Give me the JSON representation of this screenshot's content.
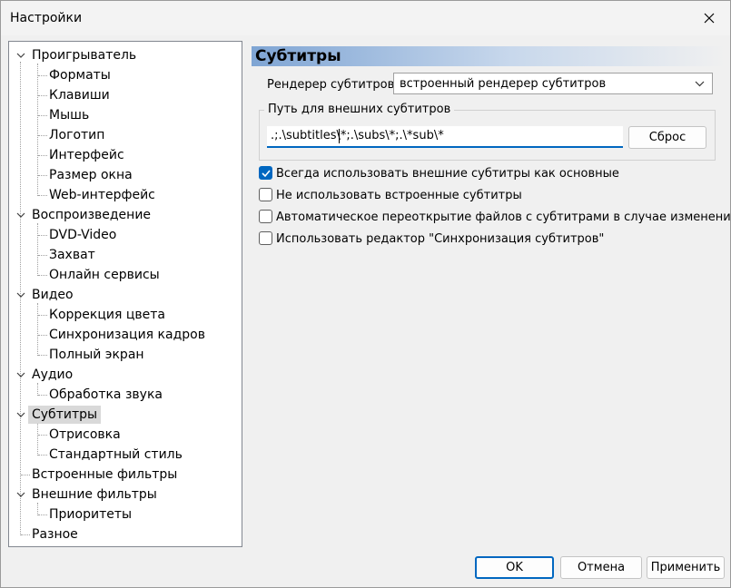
{
  "window": {
    "title": "Настройки"
  },
  "tree": {
    "items": [
      {
        "label": "Проигрыватель"
      },
      {
        "label": "Форматы"
      },
      {
        "label": "Клавиши"
      },
      {
        "label": "Мышь"
      },
      {
        "label": "Логотип"
      },
      {
        "label": "Интерфейс"
      },
      {
        "label": "Размер окна"
      },
      {
        "label": "Web-интерфейс"
      },
      {
        "label": "Воспроизведение"
      },
      {
        "label": "DVD-Video"
      },
      {
        "label": "Захват"
      },
      {
        "label": "Онлайн сервисы"
      },
      {
        "label": "Видео"
      },
      {
        "label": "Коррекция цвета"
      },
      {
        "label": "Синхронизация кадров"
      },
      {
        "label": "Полный экран"
      },
      {
        "label": "Аудио"
      },
      {
        "label": "Обработка звука"
      },
      {
        "label": "Субтитры"
      },
      {
        "label": "Отрисовка"
      },
      {
        "label": "Стандартный стиль"
      },
      {
        "label": "Встроенные фильтры"
      },
      {
        "label": "Внешние фильтры"
      },
      {
        "label": "Приоритеты"
      },
      {
        "label": "Разное"
      }
    ]
  },
  "panel": {
    "title": "Субтитры",
    "renderer_label": "Рендерер субтитров:",
    "renderer_value": "встроенный рендерер субтитров",
    "path_group_label": "Путь для внешних субтитров",
    "path_value": ".;.\\subtitles\\*;.\\subs\\*;.\\*sub\\*",
    "reset_button": "Сброс",
    "options": [
      {
        "label": "Всегда использовать внешние субтитры как основные",
        "checked": true
      },
      {
        "label": "Не использовать встроенные субтитры",
        "checked": false
      },
      {
        "label": "Автоматическое переоткрытие файлов с субтитрами в случае изменения",
        "checked": false
      },
      {
        "label": "Использовать редактор \"Синхронизация субтитров\"",
        "checked": false
      }
    ]
  },
  "buttons": {
    "ok": "OK",
    "cancel": "Отмена",
    "apply": "Применить"
  },
  "colors": {
    "accent": "#0067c0",
    "header_gradient_start": "#7fa5d4",
    "selection": "#d9d9d9"
  }
}
